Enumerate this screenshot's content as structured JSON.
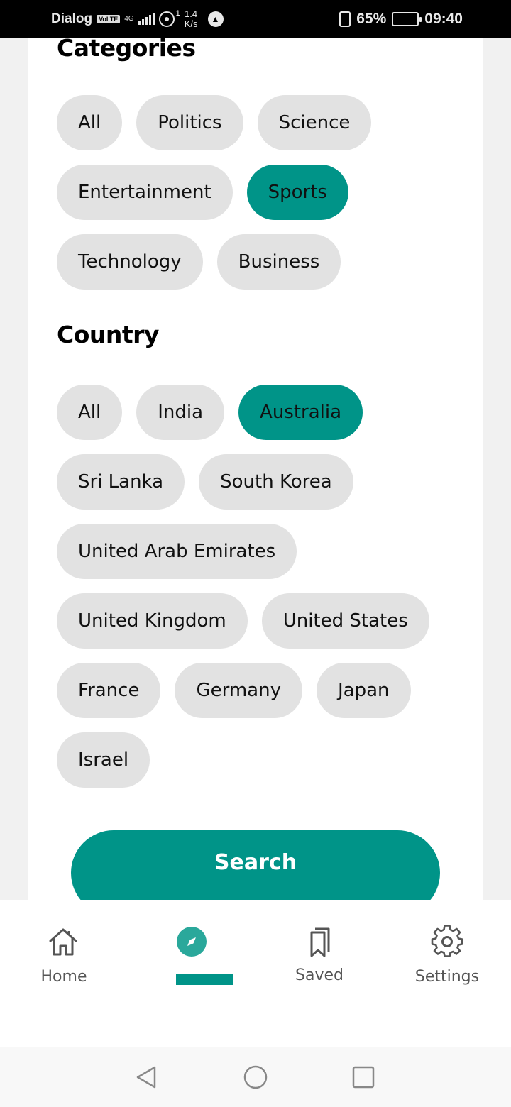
{
  "status_bar": {
    "carrier": "Dialog",
    "volte": "VoLTE",
    "network": "4G",
    "hotspot_sup": "1",
    "speed_value": "1.4",
    "speed_unit": "K/s",
    "battery_percent": "65%",
    "battery_level": 0.65,
    "time": "09:40"
  },
  "categories": {
    "title": "Categories",
    "items": [
      {
        "label": "All",
        "selected": false
      },
      {
        "label": "Politics",
        "selected": false
      },
      {
        "label": "Science",
        "selected": false
      },
      {
        "label": "Entertainment",
        "selected": false
      },
      {
        "label": "Sports",
        "selected": true
      },
      {
        "label": "Technology",
        "selected": false
      },
      {
        "label": "Business",
        "selected": false
      }
    ]
  },
  "country": {
    "title": "Country",
    "items": [
      {
        "label": "All",
        "selected": false
      },
      {
        "label": "India",
        "selected": false
      },
      {
        "label": "Australia",
        "selected": true
      },
      {
        "label": "Sri Lanka",
        "selected": false
      },
      {
        "label": "South Korea",
        "selected": false
      },
      {
        "label": "United Arab Emirates",
        "selected": false
      },
      {
        "label": "United Kingdom",
        "selected": false
      },
      {
        "label": "United States",
        "selected": false
      },
      {
        "label": "France",
        "selected": false
      },
      {
        "label": "Germany",
        "selected": false
      },
      {
        "label": "Japan",
        "selected": false
      },
      {
        "label": "Israel",
        "selected": false
      }
    ]
  },
  "search_button": {
    "label": "Search"
  },
  "bottom_nav": {
    "home_label": "Home",
    "explore_label": "",
    "saved_label": "Saved",
    "settings_label": "Settings",
    "active": "explore"
  },
  "colors": {
    "accent": "#009488",
    "chip": "#e2e2e2",
    "background": "#f1f1f1",
    "card": "#ffffff"
  },
  "icons": [
    "home-icon",
    "compass-icon",
    "bookmark-icon",
    "gear-icon",
    "back-icon",
    "home-circle-icon",
    "recents-icon"
  ]
}
